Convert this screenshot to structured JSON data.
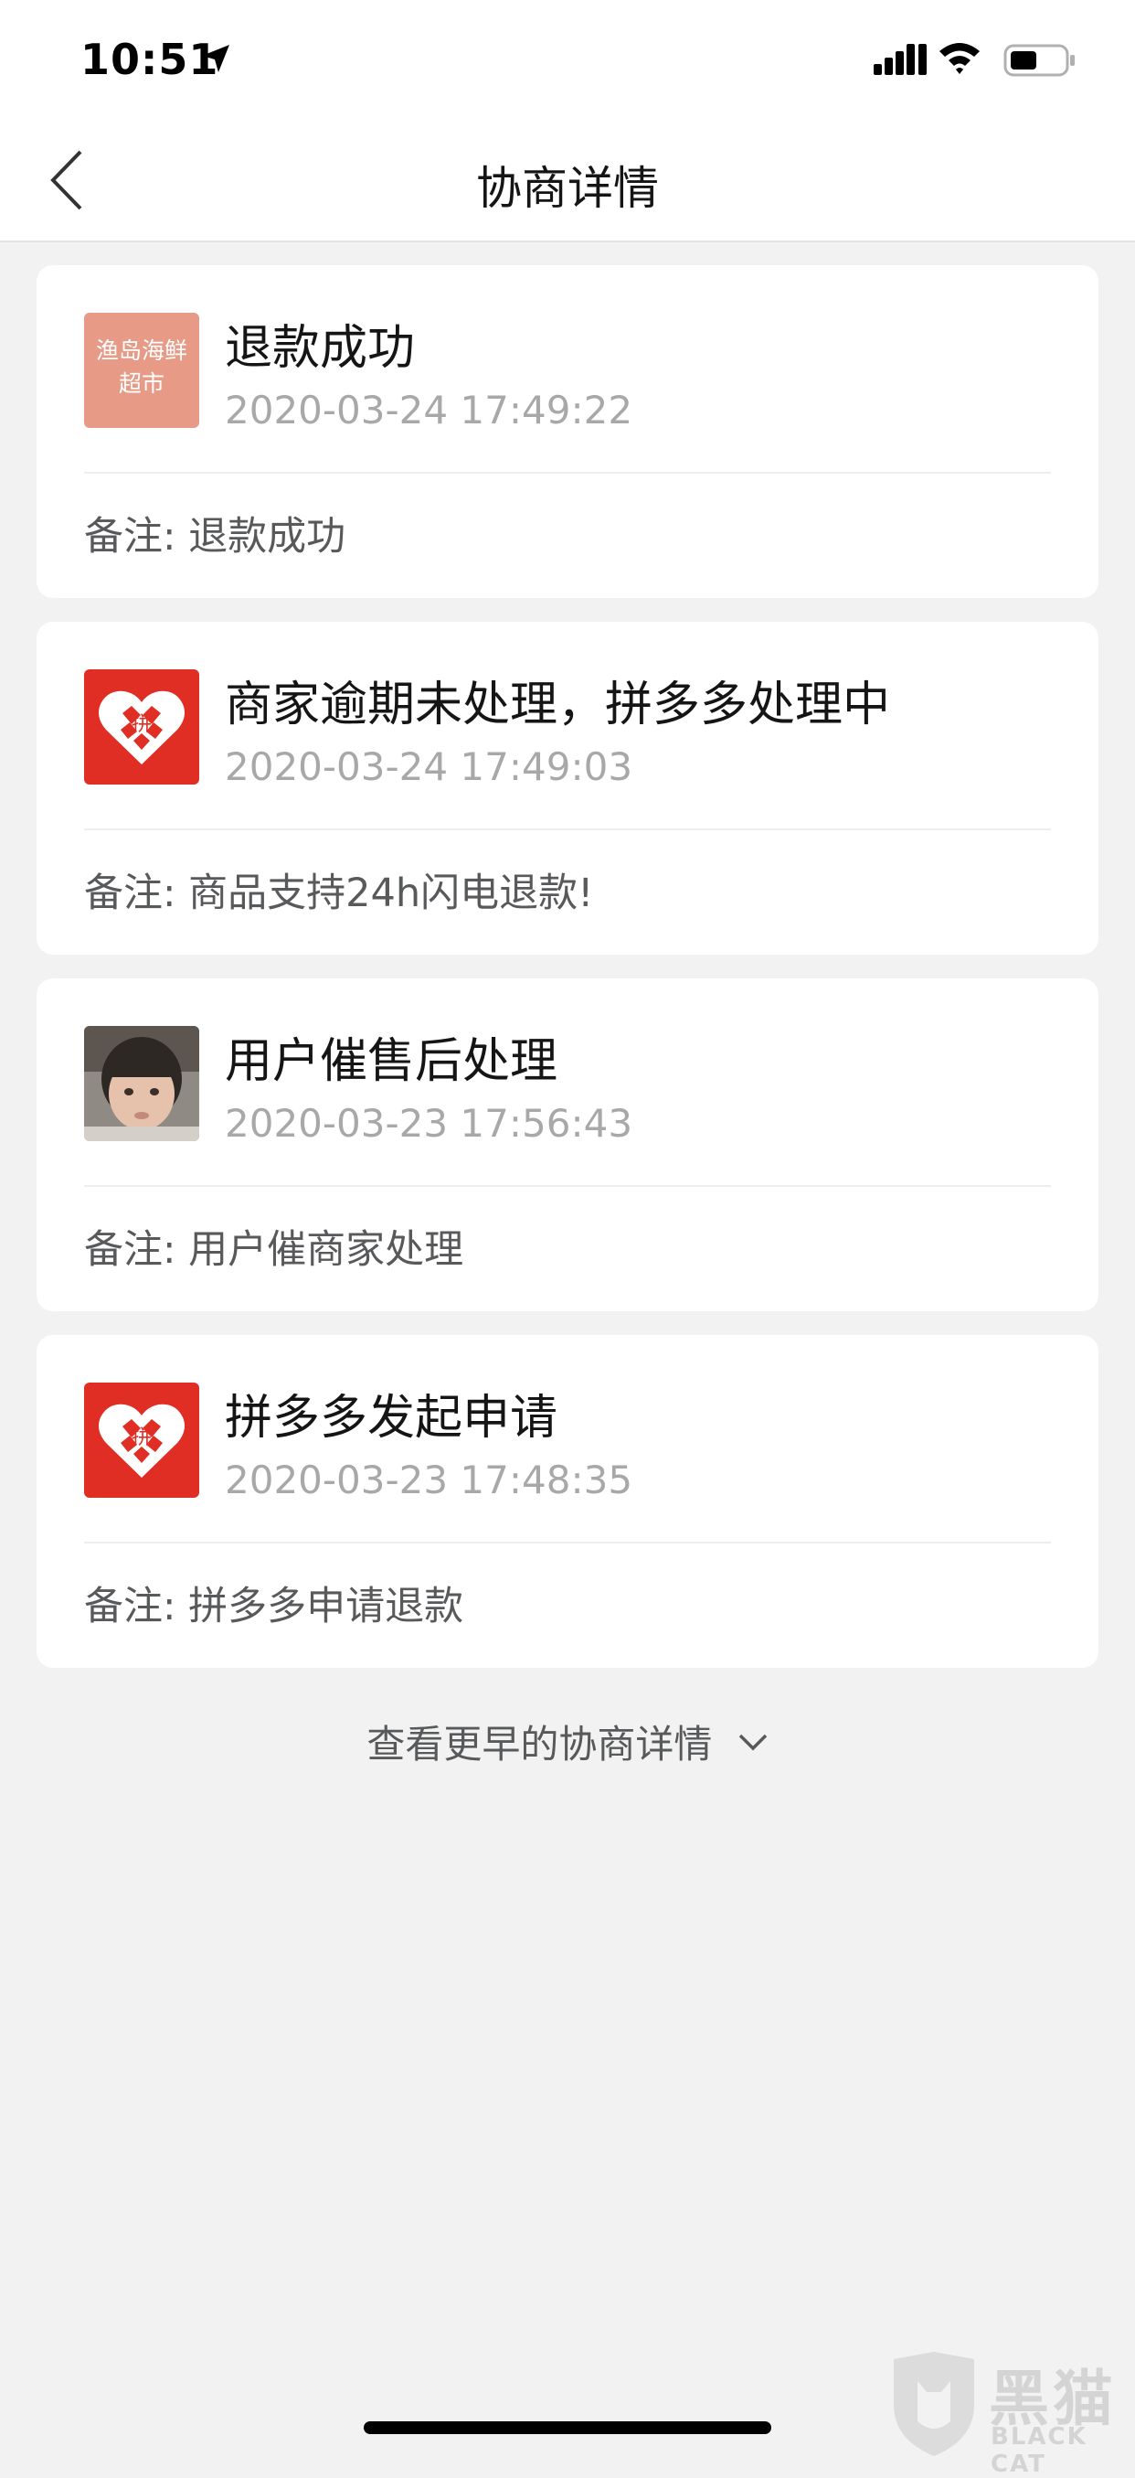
{
  "status_bar": {
    "time": "10:51"
  },
  "nav": {
    "title": "协商详情"
  },
  "events": [
    {
      "avatar_type": "shop",
      "avatar_text_1": "渔岛海鲜",
      "avatar_text_2": "超市",
      "title": "退款成功",
      "time": "2020-03-24 17:49:22",
      "note": "备注: 退款成功"
    },
    {
      "avatar_type": "pinduoduo-logo",
      "title": "商家逾期未处理，拼多多处理中",
      "time": "2020-03-24 17:49:03",
      "note": "备注: 商品支持24h闪电退款!"
    },
    {
      "avatar_type": "user-photo",
      "title": "用户催售后处理",
      "time": "2020-03-23 17:56:43",
      "note": "备注: 用户催商家处理"
    },
    {
      "avatar_type": "pinduoduo-logo",
      "title": "拼多多发起申请",
      "time": "2020-03-23 17:48:35",
      "note": "备注: 拼多多申请退款"
    }
  ],
  "more": {
    "label": "查看更早的协商详情"
  },
  "watermark": {
    "text": "黑猫",
    "sub": "BLACK CAT"
  },
  "colors": {
    "brand_red": "#e02e24",
    "shop_avatar": "#e79a86",
    "background": "#f2f2f2"
  }
}
